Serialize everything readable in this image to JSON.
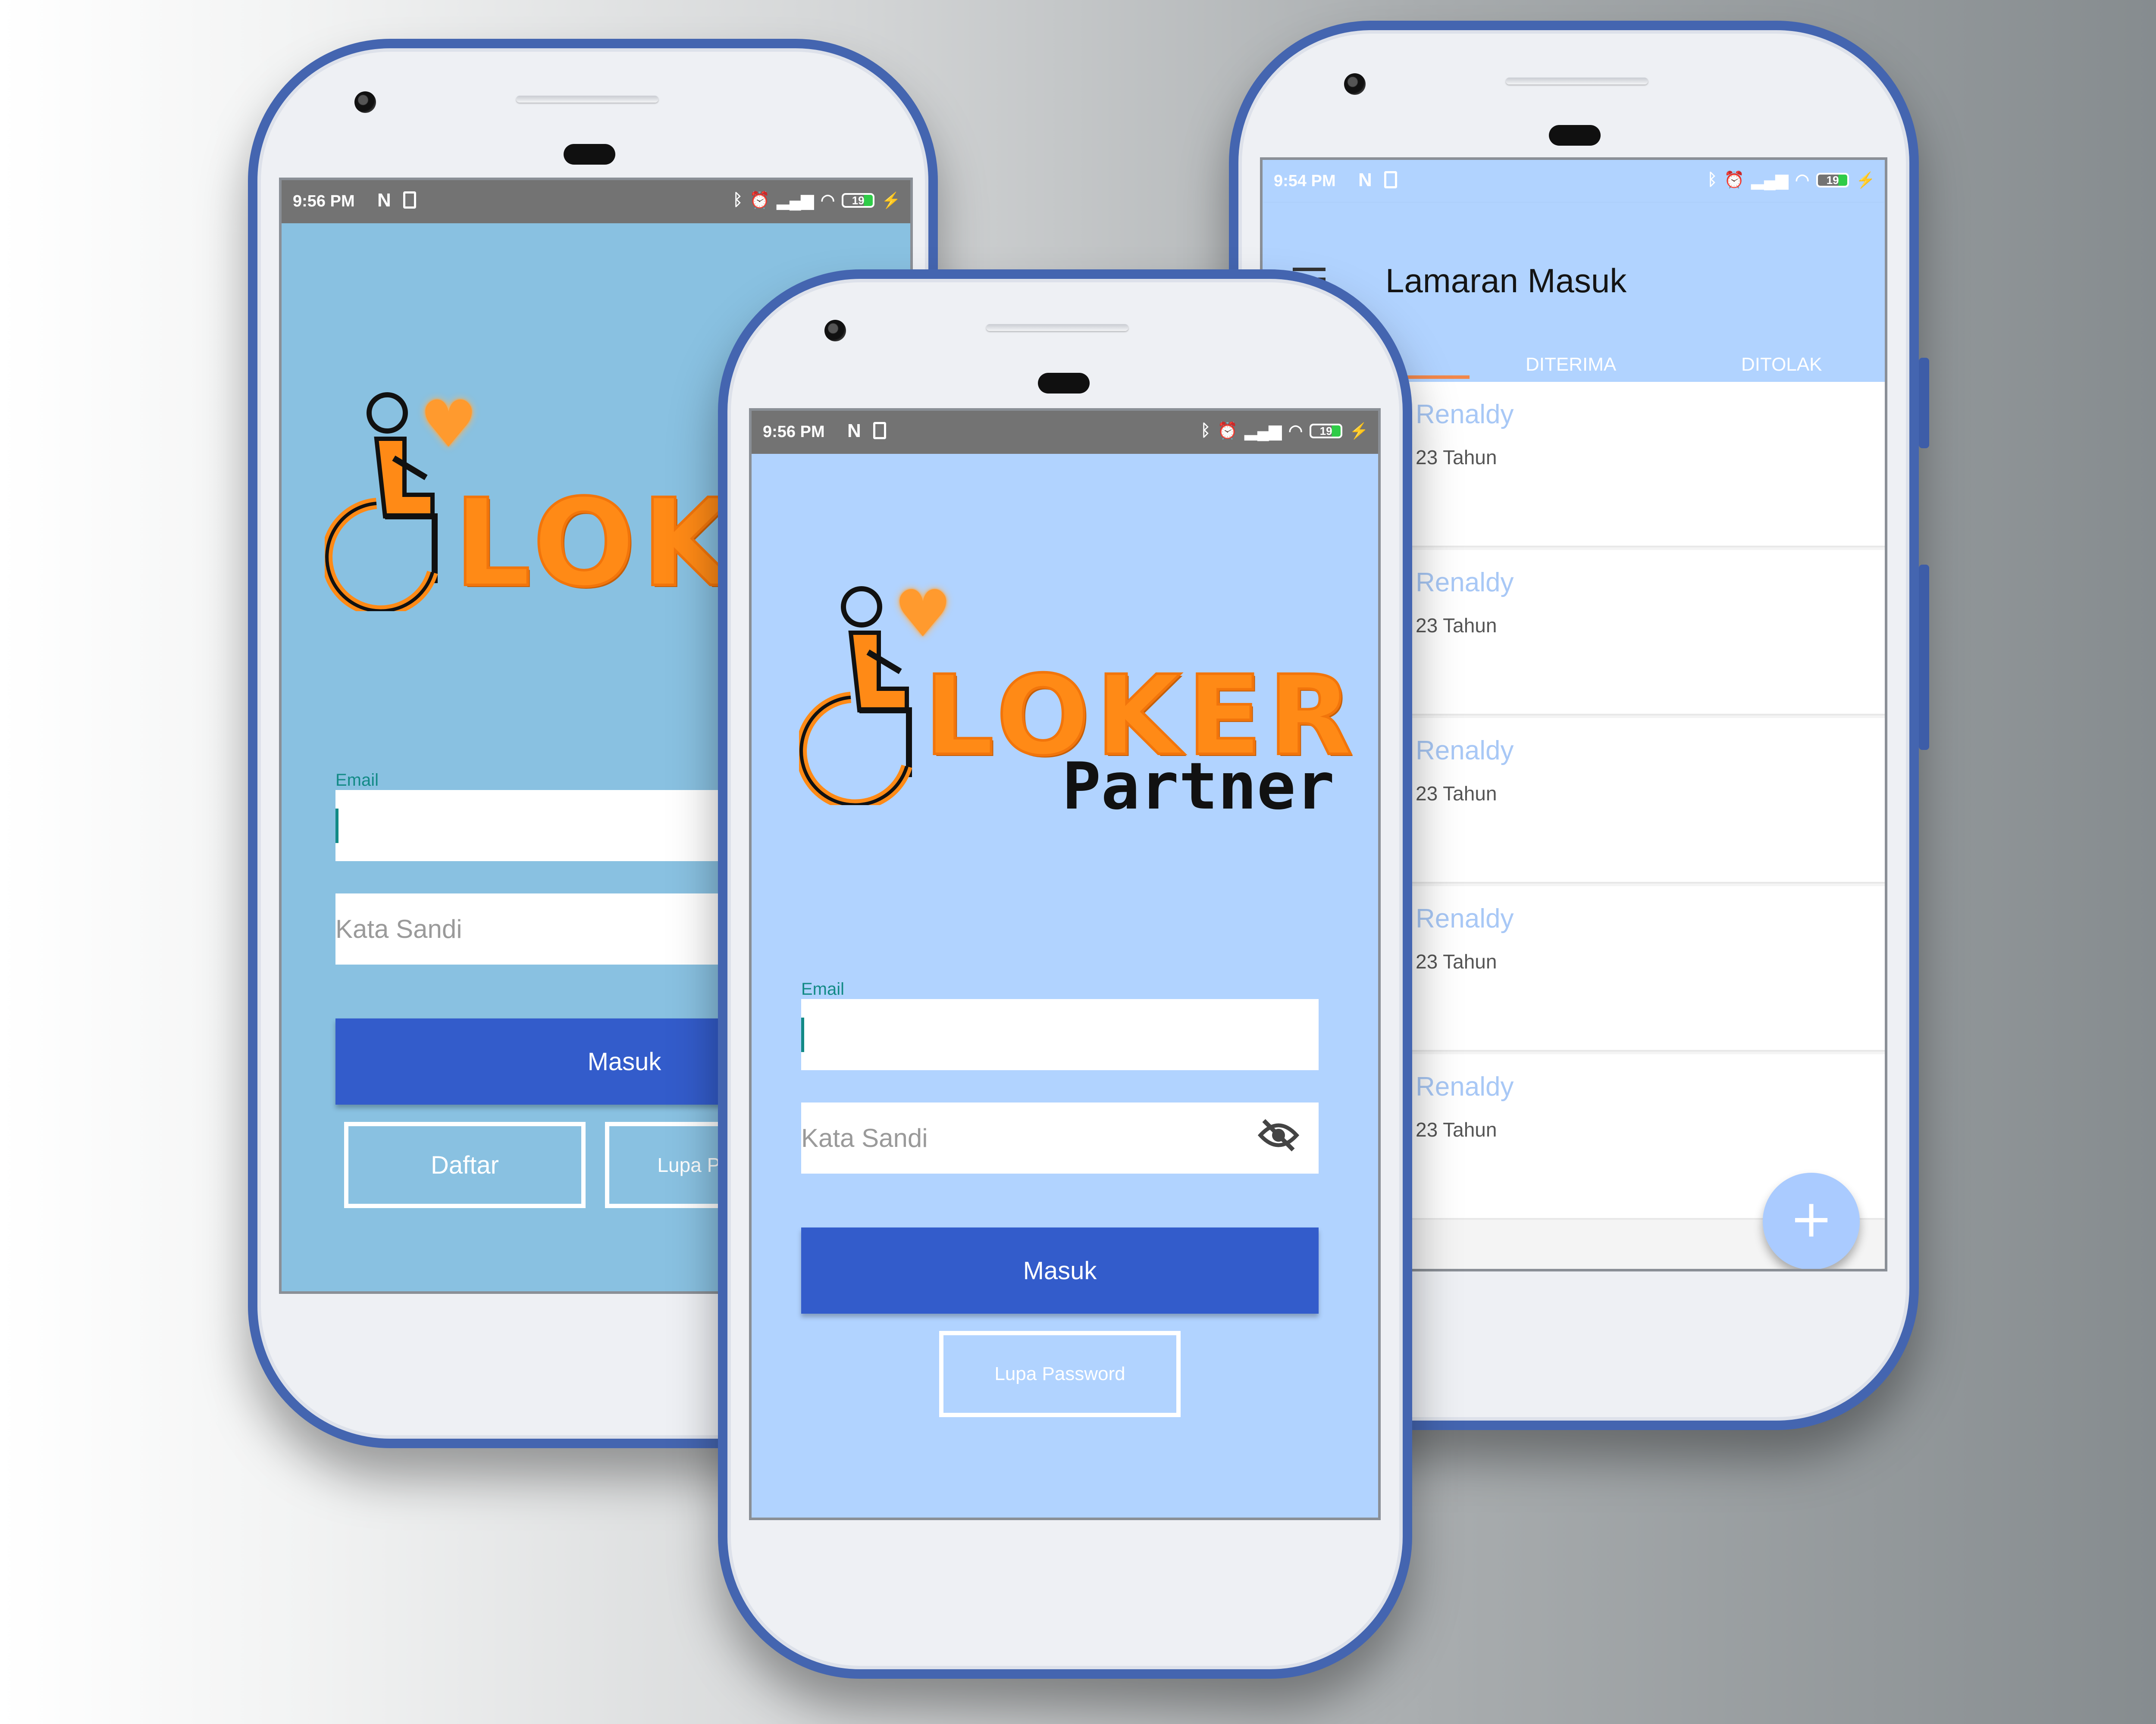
{
  "colors": {
    "brand_orange": "#ff8a16",
    "login_bg_left": "#89c1e1",
    "login_bg_center": "#b1d3ff",
    "primary_button": "#335ccb",
    "header_blue": "#b1d3ff",
    "accent_teal": "#128a86",
    "tab_indicator": "#f2874a"
  },
  "phone_left": {
    "status_bar": {
      "time": "9:56 PM",
      "battery": "19"
    },
    "logo": {
      "text": "LOKER"
    },
    "email_label": "Email",
    "email_value": "",
    "password_placeholder": "Kata Sandi",
    "login_button": "Masuk",
    "register_button": "Daftar",
    "forgot_button": "Lupa Password"
  },
  "phone_center": {
    "status_bar": {
      "time": "9:56 PM",
      "battery": "19"
    },
    "logo": {
      "text": "LOKER",
      "subtext": "Partner"
    },
    "email_label": "Email",
    "email_value": "",
    "password_placeholder": "Kata Sandi",
    "login_button": "Masuk",
    "forgot_button": "Lupa Password",
    "icons": [
      "visibility-off-icon"
    ]
  },
  "phone_right": {
    "status_bar": {
      "time": "9:54 PM",
      "battery": "19"
    },
    "title": "Lamaran Masuk",
    "tabs": [
      "DITERIMA",
      "DITOLAK"
    ],
    "applicants": [
      {
        "name": "Renaldy",
        "age": "23 Tahun"
      },
      {
        "name": "Renaldy",
        "age": "23 Tahun"
      },
      {
        "name": "Renaldy",
        "age": "23 Tahun"
      },
      {
        "name": "Renaldy",
        "age": "23 Tahun"
      },
      {
        "name": "Renaldy",
        "age": "23 Tahun"
      }
    ],
    "fab_icon": "+"
  }
}
